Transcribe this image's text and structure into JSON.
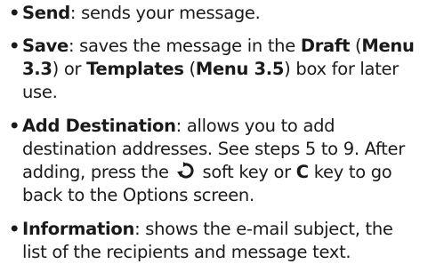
{
  "items": [
    {
      "bullet": "•",
      "lines": [
        {
          "bold": "Send",
          "rest": ": sends your message."
        }
      ]
    },
    {
      "bullet": "•",
      "line1": {
        "b1": "Save",
        "t1": ": saves the message in the ",
        "b2": "Draft",
        "t2": " (",
        "b3": "Menu"
      },
      "line2": {
        "b1": "3.3",
        "t1": ") or ",
        "b2": "Templates",
        "t2": " (",
        "b3": "Menu 3.5",
        "t3": ") box for later"
      },
      "line3": "use."
    },
    {
      "bullet": "•",
      "line1": {
        "b1": "Add Destination",
        "t1": ": allows you to add"
      },
      "line2": "destination addresses. See steps 5 to 9. After",
      "line3": {
        "t1": "adding, press the",
        "icon": "back-arrow-icon",
        "t2": "soft key or",
        "b1": "C",
        "t3": "key to go"
      },
      "line4": "back to the Options screen."
    },
    {
      "bullet": "•",
      "line1": {
        "b1": "Information",
        "t1": ": shows the e-mail subject, the"
      },
      "line2": "list of the recipients and message text."
    }
  ]
}
